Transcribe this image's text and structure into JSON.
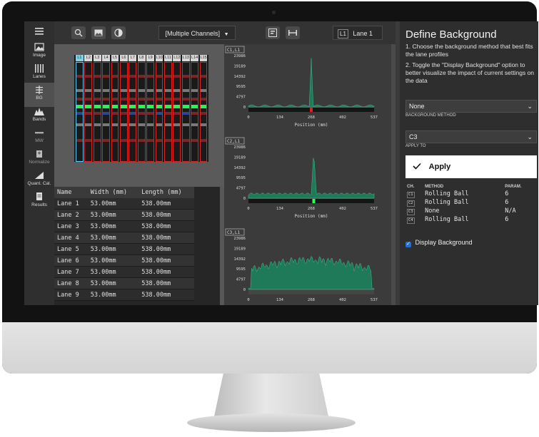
{
  "sidebar": {
    "items": [
      {
        "label": "Image",
        "icon": "image-icon"
      },
      {
        "label": "Lanes",
        "icon": "lanes-icon"
      },
      {
        "label": "BG",
        "icon": "background-icon",
        "active": true
      },
      {
        "label": "Bands",
        "icon": "bands-icon"
      },
      {
        "label": "MW",
        "icon": "molecular-weight-icon"
      },
      {
        "label": "Normalize",
        "icon": "normalize-icon"
      },
      {
        "label": "Quant. Cal.",
        "icon": "quant-calibration-icon"
      },
      {
        "label": "Results",
        "icon": "results-icon"
      }
    ]
  },
  "toolbar": {
    "channel_dropdown": "[Multiple Channels]",
    "lane_chip": "L1",
    "lane_dropdown": "Lane 1"
  },
  "gel": {
    "lane_tabs": [
      "L1",
      "L2",
      "L3",
      "L4",
      "L5",
      "L6",
      "L7",
      "L8",
      "L9",
      "L10",
      "L11",
      "L12",
      "L13",
      "L14",
      "L15"
    ]
  },
  "lane_table": {
    "headers": [
      "Name",
      "Width (mm)",
      "Length (mm)"
    ],
    "rows": [
      [
        "Lane 1",
        "53.00mm",
        "538.00mm"
      ],
      [
        "Lane 2",
        "53.00mm",
        "538.00mm"
      ],
      [
        "Lane 3",
        "53.00mm",
        "538.00mm"
      ],
      [
        "Lane 4",
        "53.00mm",
        "538.00mm"
      ],
      [
        "Lane 5",
        "53.00mm",
        "538.00mm"
      ],
      [
        "Lane 6",
        "53.00mm",
        "538.00mm"
      ],
      [
        "Lane 7",
        "53.00mm",
        "538.00mm"
      ],
      [
        "Lane 8",
        "53.00mm",
        "538.00mm"
      ],
      [
        "Lane 9",
        "53.00mm",
        "538.00mm"
      ]
    ]
  },
  "plots": [
    {
      "tag": "C1,L1",
      "y_ticks": [
        "23986",
        "19189",
        "14392",
        "9595",
        "4797",
        "0"
      ],
      "x_ticks": [
        "0",
        "134",
        "268",
        "402",
        "537"
      ],
      "xlabel": "Position (mm)"
    },
    {
      "tag": "C2,L1",
      "y_ticks": [
        "23986",
        "19189",
        "14392",
        "9595",
        "4797",
        "0"
      ],
      "x_ticks": [
        "0",
        "134",
        "268",
        "402",
        "537"
      ],
      "xlabel": "Position (mm)"
    },
    {
      "tag": "C3,L1",
      "y_ticks": [
        "23986",
        "19189",
        "14392",
        "9595",
        "4797",
        "0"
      ],
      "x_ticks": [
        "0",
        "134",
        "268",
        "402",
        "537"
      ],
      "xlabel": ""
    }
  ],
  "panel": {
    "title": "Define Background",
    "step1": "1. Choose the background method that best fits the lane profiles",
    "step2": "2. Toggle the \"Display Background\" option to better visualize the impact of current settings on the data",
    "method_value": "None",
    "method_label": "BACKGROUND METHOD",
    "apply_to_value": "C3",
    "apply_to_label": "APPLY TO",
    "apply_button": "Apply",
    "channel_table": {
      "headers": [
        "CH.",
        "METHOD",
        "PARAM."
      ],
      "rows": [
        [
          "C1",
          "Rolling Ball",
          "6"
        ],
        [
          "C2",
          "Rolling Ball",
          "6"
        ],
        [
          "C3",
          "None",
          "N/A"
        ],
        [
          "C4",
          "Rolling Ball",
          "6"
        ]
      ]
    },
    "display_background_label": "Display Background",
    "display_background_checked": true
  },
  "colors": {
    "plot_fill": "#1f7a5a",
    "lane_outline": "#e02020",
    "accent_checkbox": "#1e6fd9"
  }
}
